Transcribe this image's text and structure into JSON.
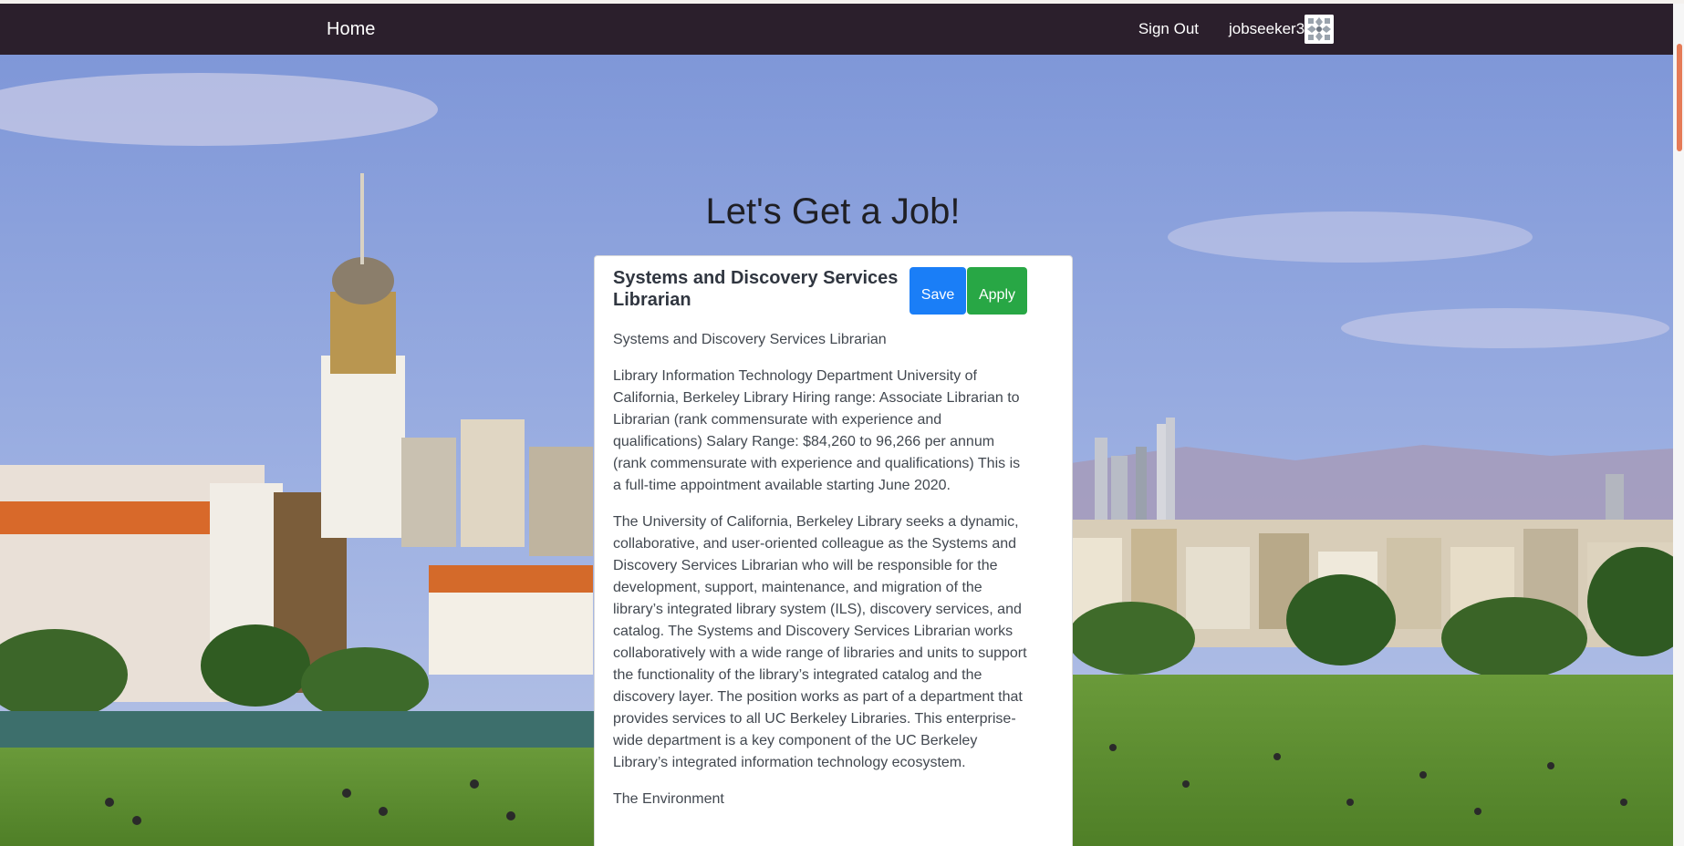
{
  "navbar": {
    "home_label": "Home",
    "signout_label": "Sign Out",
    "username": "jobseeker3"
  },
  "hero": {
    "headline": "Let's Get a Job!"
  },
  "job": {
    "title": "Systems and Discovery Services Librarian",
    "save_label": "Save",
    "apply_label": "Apply",
    "paragraphs": [
      "Systems and Discovery Services Librarian",
      "Library Information Technology Department University of California, Berkeley Library Hiring range: Associate Librarian to Librarian (rank commensurate with experience and qualifications) Salary Range: $84,260 to 96,266 per annum (rank commensurate with experience and qualifications) This is a full-time appointment available starting June 2020.",
      "The University of California, Berkeley Library seeks a dynamic, collaborative, and user-oriented colleague as the Systems and Discovery Services Librarian who will be responsible for the development, support, maintenance, and migration of the library’s integrated library system (ILS), discovery services, and catalog. The Systems and Discovery Services Librarian works collaboratively with a wide range of libraries and units to support the functionality of the library’s integrated catalog and the discovery layer. The position works as part of a department that provides services to all UC Berkeley Libraries. This enterprise-wide department is a key component of the UC Berkeley Library’s integrated information technology ecosystem.",
      "The Environment"
    ]
  },
  "colors": {
    "navbar": "#2b1f2c",
    "save_button": "#1a7ef7",
    "apply_button": "#28a745",
    "scrollbar_thumb": "#e57b57"
  },
  "icons": {
    "avatar": "identicon-avatar"
  }
}
